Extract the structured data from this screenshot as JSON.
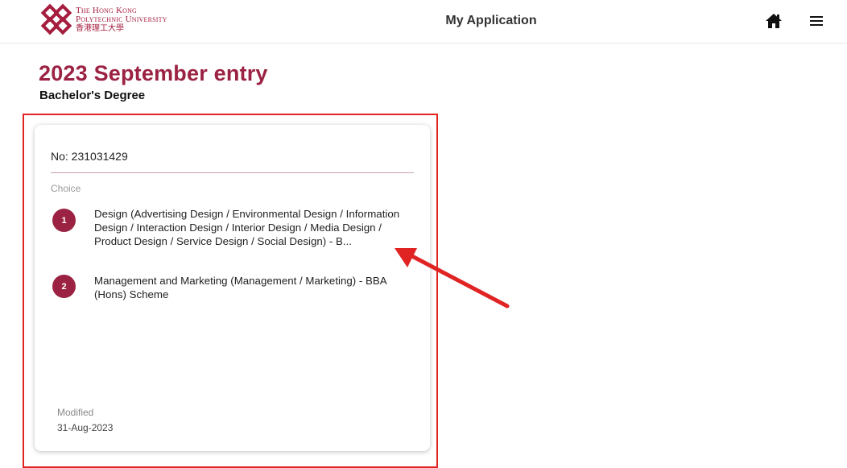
{
  "header": {
    "logo": {
      "line1": "The Hong Kong",
      "line2": "Polytechnic University",
      "line3": "香港理工大學"
    },
    "title": "My Application",
    "icons": {
      "home": "home-icon",
      "menu": "hamburger-menu-icon"
    }
  },
  "page": {
    "entry_title": "2023 September entry",
    "degree": "Bachelor's Degree"
  },
  "application": {
    "number": "No: 231031429",
    "choice_label": "Choice",
    "choices": [
      {
        "rank": "1",
        "programme": "Design (Advertising Design / Environmental Design / Information Design / Interaction Design / Interior Design / Media Design / Product Design / Service Design / Social Design) - B..."
      },
      {
        "rank": "2",
        "programme": "Management and Marketing (Management / Marketing) - BBA (Hons) Scheme"
      }
    ],
    "modified_label": "Modified",
    "modified_date": "31-Aug-2023"
  },
  "colors": {
    "brand": "#9b2242",
    "annotation": "#e02424"
  }
}
